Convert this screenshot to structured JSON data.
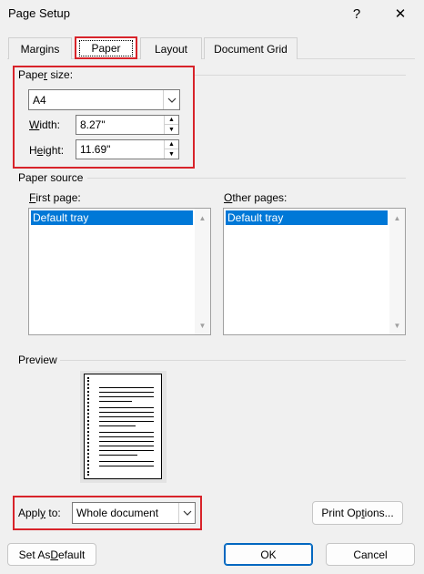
{
  "window": {
    "title": "Page Setup",
    "help_glyph": "?",
    "close_glyph": "✕"
  },
  "tabs": [
    {
      "label": "Margins"
    },
    {
      "label": "Paper"
    },
    {
      "label": "Layout"
    },
    {
      "label": "Document Grid"
    }
  ],
  "paper_size": {
    "group_label_pre": "Pape",
    "group_label_mn": "r",
    "group_label_post": " size:",
    "selected": "A4",
    "width_label_pre": "",
    "width_label_mn": "W",
    "width_label_post": "idth:",
    "width_value": "8.27\"",
    "height_label_pre": "H",
    "height_label_mn": "e",
    "height_label_post": "ight:",
    "height_value": "11.69\""
  },
  "paper_source": {
    "group_label": "Paper source",
    "first_page_mn": "F",
    "first_page_rest": "irst page:",
    "first_page_selected": "Default tray",
    "other_pages_mn": "O",
    "other_pages_rest": "ther pages:",
    "other_pages_selected": "Default tray"
  },
  "preview": {
    "label": "Preview"
  },
  "apply_to": {
    "label_pre": "Appl",
    "label_mn": "y",
    "label_post": " to:",
    "selected": "Whole document"
  },
  "buttons": {
    "print_options_pre": "Print Op",
    "print_options_mn": "t",
    "print_options_post": "ions...",
    "set_default_pre": "Set As ",
    "set_default_mn": "D",
    "set_default_post": "efault",
    "ok": "OK",
    "cancel": "Cancel"
  },
  "colors": {
    "highlight_box": "#d8232a",
    "selection": "#0078d7",
    "default_button_border": "#0067c0"
  }
}
